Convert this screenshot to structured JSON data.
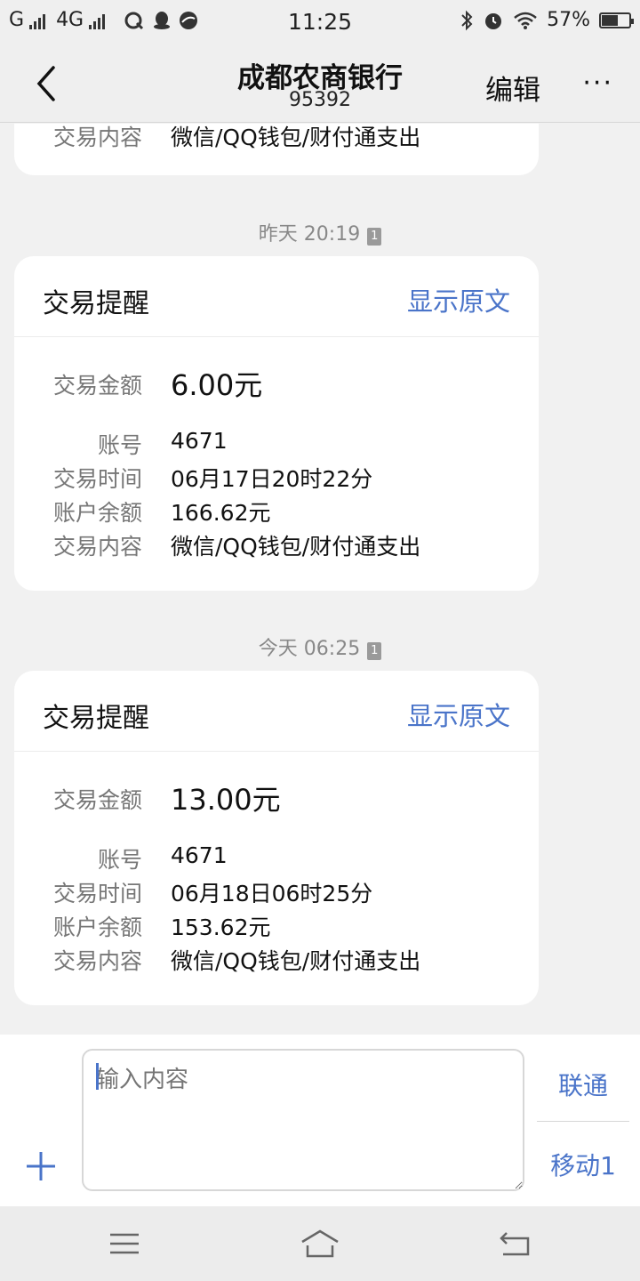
{
  "status_bar": {
    "carrier1": "G",
    "carrier2": "4G",
    "time": "11:25",
    "battery": "57%",
    "battery_level": 0.57
  },
  "header": {
    "title": "成都农商银行",
    "number": "95392",
    "edit": "编辑",
    "more": "···"
  },
  "previous_card": {
    "label": "交易内容",
    "value": "微信/QQ钱包/财付通支出"
  },
  "messages": [
    {
      "timestamp": "昨天 20:19",
      "sim_badge": "1",
      "card_title": "交易提醒",
      "show_original": "显示原文",
      "amount_label": "交易金额",
      "amount": "6.00元",
      "fields": [
        {
          "label": "账号",
          "value": "4671"
        },
        {
          "label": "交易时间",
          "value": "06月17日20时22分"
        },
        {
          "label": "账户余额",
          "value": "166.62元"
        },
        {
          "label": "交易内容",
          "value": "微信/QQ钱包/财付通支出"
        }
      ]
    },
    {
      "timestamp": "今天 06:25",
      "sim_badge": "1",
      "card_title": "交易提醒",
      "show_original": "显示原文",
      "amount_label": "交易金额",
      "amount": "13.00元",
      "fields": [
        {
          "label": "账号",
          "value": "4671"
        },
        {
          "label": "交易时间",
          "value": "06月18日06时25分"
        },
        {
          "label": "账户余额",
          "value": "153.62元"
        },
        {
          "label": "交易内容",
          "value": "微信/QQ钱包/财付通支出"
        }
      ]
    }
  ],
  "composer": {
    "placeholder": "输入内容",
    "sim1_label": "联通",
    "sim2_label": "移动1"
  },
  "colors": {
    "accent": "#4a74c9",
    "background": "#f1f1f1",
    "card": "#ffffff"
  },
  "icons": [
    "back-arrow-icon",
    "more-icon",
    "plus-icon",
    "menu-icon",
    "home-icon",
    "return-icon",
    "bluetooth-icon",
    "alarm-icon",
    "wifi-icon",
    "battery-icon"
  ]
}
